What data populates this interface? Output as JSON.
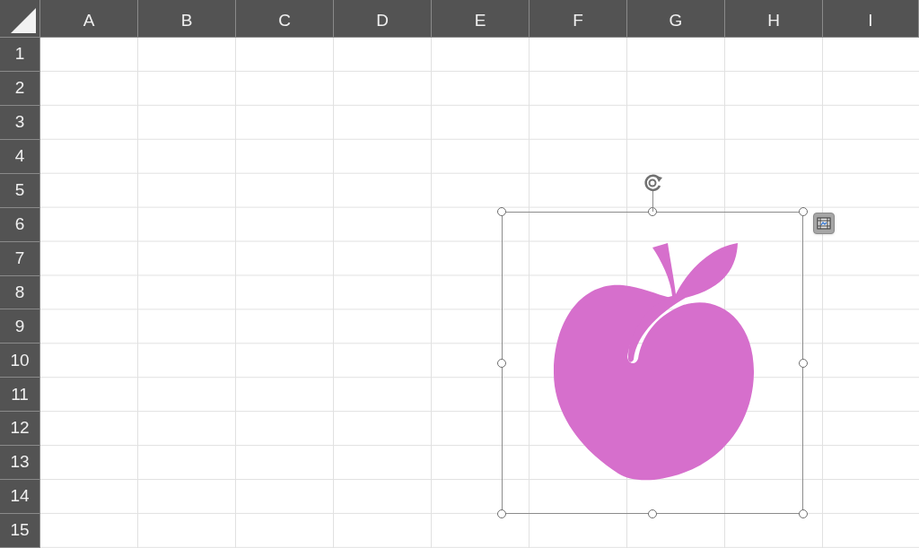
{
  "columns": [
    "A",
    "B",
    "C",
    "D",
    "E",
    "F",
    "G",
    "H",
    "I"
  ],
  "rows": [
    "1",
    "2",
    "3",
    "4",
    "5",
    "6",
    "7",
    "8",
    "9",
    "10",
    "11",
    "12",
    "13",
    "14",
    "15"
  ],
  "shape": {
    "kind": "peach",
    "color": "#d66fcc",
    "selected": true
  }
}
